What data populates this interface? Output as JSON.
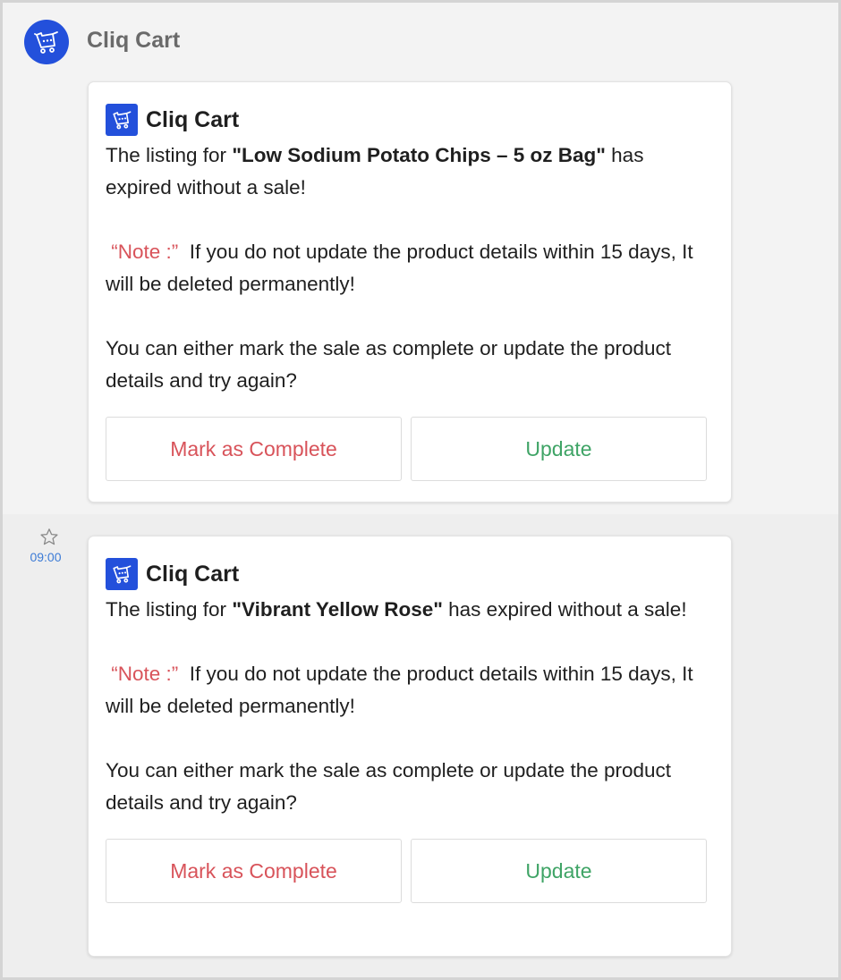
{
  "app": {
    "bot_name": "Cliq Cart"
  },
  "messages": [
    {
      "card_title": "Cliq Cart",
      "listing_prefix": "The listing for ",
      "product": "\"Low Sodium Potato Chips – 5 oz Bag\"",
      "listing_suffix": " has expired without a sale!",
      "note_label": "“Note :”",
      "note_text": "If you do not update the product details within 15 days, It will be deleted permanently!",
      "prompt": "You can either mark the sale as complete or update the product details and try again?",
      "buttons": {
        "complete": "Mark as Complete",
        "update": "Update"
      }
    },
    {
      "time": "09:00",
      "card_title": "Cliq Cart",
      "listing_prefix": "The listing for ",
      "product": "\"Vibrant Yellow Rose\"",
      "listing_suffix": " has expired without a sale!",
      "note_label": "“Note :”",
      "note_text": "If you do not update the product details within 15 days, It will be deleted permanently!",
      "prompt": "You can either mark the sale as complete or update the product details and try again?",
      "buttons": {
        "complete": "Mark as Complete",
        "update": "Update"
      }
    }
  ],
  "colors": {
    "brand_blue": "#2350db",
    "note_red": "#d8535a",
    "update_green": "#3fa466",
    "time_blue": "#3c7bd6"
  },
  "icons": [
    "cart-logo-icon",
    "star-icon"
  ]
}
